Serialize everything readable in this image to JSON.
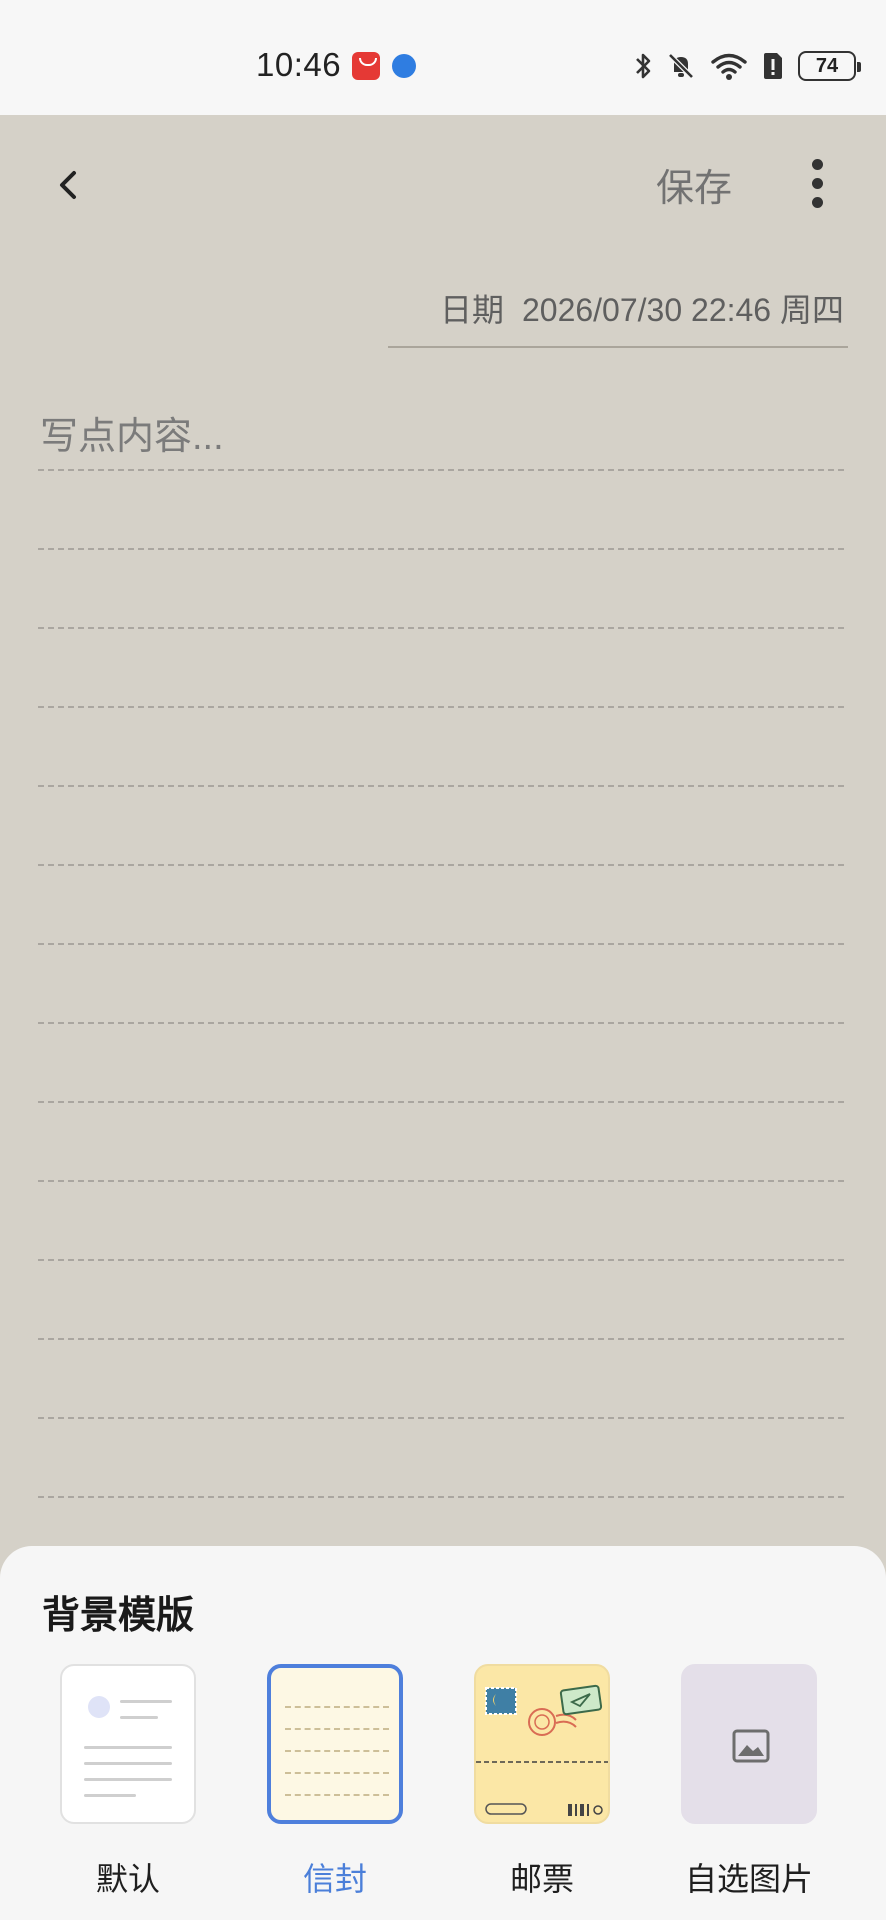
{
  "status_bar": {
    "time": "10:46",
    "battery_level": "74",
    "icons": [
      "huawei-appgallery-icon",
      "browser-globe-icon",
      "bluetooth-icon",
      "bell-muted-icon",
      "wifi-icon",
      "sim-alert-icon",
      "battery-icon"
    ]
  },
  "editor": {
    "save_label": "保存",
    "date_label": "日期",
    "date_value": "2026/07/30 22:46 周四",
    "content_placeholder": "写点内容...",
    "background_color": "#d5d1c8",
    "line_count": 14
  },
  "templates": {
    "title": "背景模版",
    "items": [
      {
        "label": "默认",
        "selected": false
      },
      {
        "label": "信封",
        "selected": true
      },
      {
        "label": "邮票",
        "selected": false
      },
      {
        "label": "自选图片",
        "selected": false
      }
    ]
  },
  "colors": {
    "accent": "#4e7fdc",
    "save_text": "#727272"
  }
}
